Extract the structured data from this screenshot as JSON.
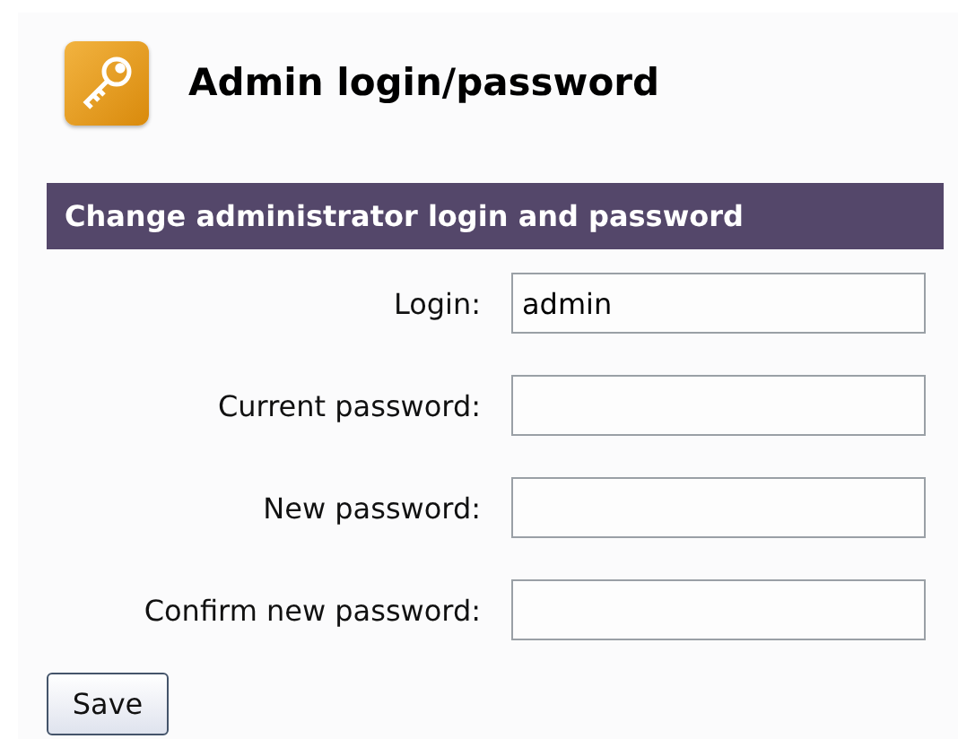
{
  "page": {
    "title": "Admin login/password"
  },
  "section": {
    "title": "Change administrator login and password"
  },
  "fields": [
    {
      "label": "Login:",
      "value": "admin"
    },
    {
      "label": "Current password:"
    },
    {
      "label": "New password:"
    },
    {
      "label": "Confirm new password:"
    }
  ],
  "buttons": [
    "Save"
  ]
}
